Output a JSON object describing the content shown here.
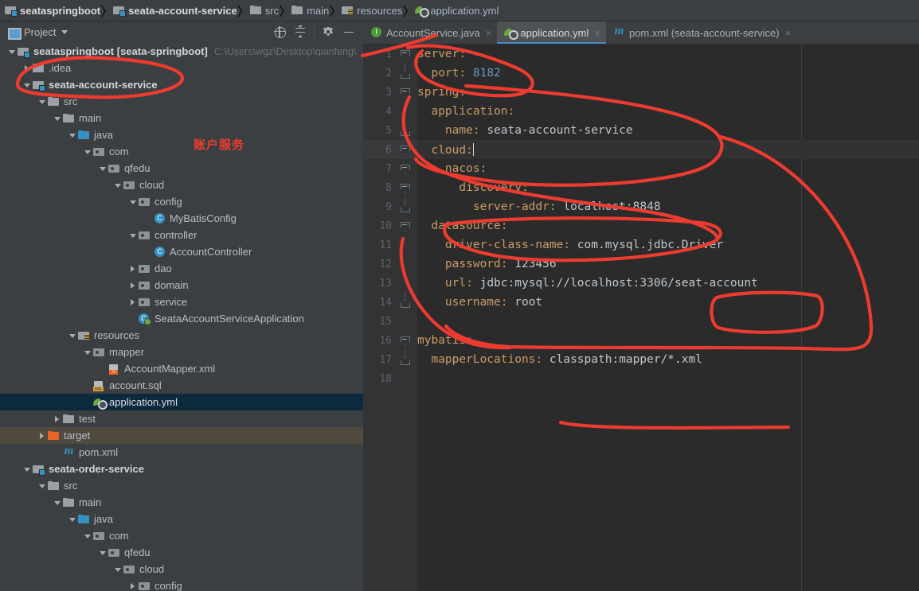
{
  "breadcrumb": [
    {
      "label": "seataspringboot",
      "icon": "module-icon",
      "bold": true
    },
    {
      "label": "seata-account-service",
      "icon": "module-icon",
      "bold": true
    },
    {
      "label": "src",
      "icon": "folder-icon",
      "bold": false
    },
    {
      "label": "main",
      "icon": "folder-icon",
      "bold": false
    },
    {
      "label": "resources",
      "icon": "resources-folder-icon",
      "bold": false
    },
    {
      "label": "application.yml",
      "icon": "yml-icon",
      "bold": false
    }
  ],
  "sidebar": {
    "title": "Project",
    "tools": [
      {
        "name": "locate-icon",
        "label": ""
      },
      {
        "name": "collapse-all-icon",
        "label": ""
      },
      {
        "name": "settings-gear-icon",
        "label": ""
      },
      {
        "name": "minimize-icon",
        "label": ""
      }
    ],
    "annotation_cn": "账户服务",
    "tree": [
      {
        "label": "seataspringboot [seata-springboot]",
        "path": "C:\\Users\\wgz\\Desktop\\qianfeng\\",
        "depth": 0,
        "arrow": "down",
        "icon": "module-icon",
        "bold": true,
        "state": "none"
      },
      {
        "label": ".idea",
        "depth": 1,
        "arrow": "right",
        "icon": "folder-icon",
        "bold": false,
        "state": "none"
      },
      {
        "label": "seata-account-service",
        "depth": 1,
        "arrow": "down",
        "icon": "module-icon",
        "bold": true,
        "state": "none"
      },
      {
        "label": "src",
        "depth": 2,
        "arrow": "down",
        "icon": "folder-icon",
        "bold": false,
        "state": "none"
      },
      {
        "label": "main",
        "depth": 3,
        "arrow": "down",
        "icon": "folder-icon",
        "bold": false,
        "state": "none"
      },
      {
        "label": "java",
        "depth": 4,
        "arrow": "down",
        "icon": "java-folder-icon",
        "bold": false,
        "state": "none"
      },
      {
        "label": "com",
        "depth": 5,
        "arrow": "down",
        "icon": "package-icon",
        "bold": false,
        "state": "none"
      },
      {
        "label": "qfedu",
        "depth": 6,
        "arrow": "down",
        "icon": "package-icon",
        "bold": false,
        "state": "none"
      },
      {
        "label": "cloud",
        "depth": 7,
        "arrow": "down",
        "icon": "package-icon",
        "bold": false,
        "state": "none"
      },
      {
        "label": "config",
        "depth": 8,
        "arrow": "down",
        "icon": "package-icon",
        "bold": false,
        "state": "none"
      },
      {
        "label": "MyBatisConfig",
        "depth": 9,
        "arrow": "none",
        "icon": "class-icon",
        "bold": false,
        "state": "none"
      },
      {
        "label": "controller",
        "depth": 8,
        "arrow": "down",
        "icon": "package-icon",
        "bold": false,
        "state": "none"
      },
      {
        "label": "AccountController",
        "depth": 9,
        "arrow": "none",
        "icon": "class-icon",
        "bold": false,
        "state": "none"
      },
      {
        "label": "dao",
        "depth": 8,
        "arrow": "right",
        "icon": "package-icon",
        "bold": false,
        "state": "none"
      },
      {
        "label": "domain",
        "depth": 8,
        "arrow": "right",
        "icon": "package-icon",
        "bold": false,
        "state": "none"
      },
      {
        "label": "service",
        "depth": 8,
        "arrow": "right",
        "icon": "package-icon",
        "bold": false,
        "state": "none"
      },
      {
        "label": "SeataAccountServiceApplication",
        "depth": 8,
        "arrow": "none",
        "icon": "spring-class-icon",
        "bold": false,
        "state": "none"
      },
      {
        "label": "resources",
        "depth": 4,
        "arrow": "down",
        "icon": "resources-folder-icon",
        "bold": false,
        "state": "none"
      },
      {
        "label": "mapper",
        "depth": 5,
        "arrow": "down",
        "icon": "package-icon",
        "bold": false,
        "state": "none"
      },
      {
        "label": "AccountMapper.xml",
        "depth": 6,
        "arrow": "none",
        "icon": "xml-icon",
        "bold": false,
        "state": "none"
      },
      {
        "label": "account.sql",
        "depth": 5,
        "arrow": "none",
        "icon": "sql-icon",
        "bold": false,
        "state": "none"
      },
      {
        "label": "application.yml",
        "depth": 5,
        "arrow": "none",
        "icon": "yml-icon",
        "bold": false,
        "state": "selected"
      },
      {
        "label": "test",
        "depth": 3,
        "arrow": "right",
        "icon": "folder-icon",
        "bold": false,
        "state": "none"
      },
      {
        "label": "target",
        "depth": 2,
        "arrow": "right",
        "icon": "target-folder-icon",
        "bold": false,
        "state": "highlight"
      },
      {
        "label": "pom.xml",
        "depth": 3,
        "arrow": "none",
        "icon": "maven-icon",
        "bold": false,
        "state": "none"
      },
      {
        "label": "seata-order-service",
        "depth": 1,
        "arrow": "down",
        "icon": "module-icon",
        "bold": true,
        "state": "none"
      },
      {
        "label": "src",
        "depth": 2,
        "arrow": "down",
        "icon": "folder-icon",
        "bold": false,
        "state": "none"
      },
      {
        "label": "main",
        "depth": 3,
        "arrow": "down",
        "icon": "folder-icon",
        "bold": false,
        "state": "none"
      },
      {
        "label": "java",
        "depth": 4,
        "arrow": "down",
        "icon": "java-folder-icon",
        "bold": false,
        "state": "none"
      },
      {
        "label": "com",
        "depth": 5,
        "arrow": "down",
        "icon": "package-icon",
        "bold": false,
        "state": "none"
      },
      {
        "label": "qfedu",
        "depth": 6,
        "arrow": "down",
        "icon": "package-icon",
        "bold": false,
        "state": "none"
      },
      {
        "label": "cloud",
        "depth": 7,
        "arrow": "down",
        "icon": "package-icon",
        "bold": false,
        "state": "none"
      },
      {
        "label": "config",
        "depth": 8,
        "arrow": "right",
        "icon": "package-icon",
        "bold": false,
        "state": "none"
      }
    ]
  },
  "editor": {
    "tabs": [
      {
        "label": "AccountService.java",
        "icon": "interface-icon",
        "active": false,
        "close": "×"
      },
      {
        "label": "application.yml",
        "icon": "yml-icon",
        "active": true,
        "close": "×"
      },
      {
        "label": "pom.xml (seata-account-service)",
        "icon": "maven-icon",
        "active": false,
        "close": "×"
      }
    ],
    "filename": "application.yml",
    "current_line": 6,
    "lines": [
      {
        "num": "1",
        "fold": "top",
        "indent": 0,
        "key": "server",
        "sep": ":",
        "value": "",
        "vtype": "none"
      },
      {
        "num": "2",
        "fold": "bot",
        "indent": 1,
        "key": "port",
        "sep": ": ",
        "value": "8182",
        "vtype": "num"
      },
      {
        "num": "3",
        "fold": "top",
        "indent": 0,
        "key": "spring",
        "sep": ":",
        "value": "",
        "vtype": "none"
      },
      {
        "num": "4",
        "fold": "mid",
        "indent": 1,
        "key": "application",
        "sep": ":",
        "value": "",
        "vtype": "none"
      },
      {
        "num": "5",
        "fold": "bot",
        "indent": 2,
        "key": "name",
        "sep": ": ",
        "value": "seata-account-service",
        "vtype": "str"
      },
      {
        "num": "6",
        "fold": "top",
        "indent": 1,
        "key": "cloud",
        "sep": ":",
        "value": "",
        "vtype": "caret"
      },
      {
        "num": "7",
        "fold": "top",
        "indent": 2,
        "key": "nacos",
        "sep": ":",
        "value": "",
        "vtype": "none"
      },
      {
        "num": "8",
        "fold": "top",
        "indent": 3,
        "key": "discovery",
        "sep": ":",
        "value": "",
        "vtype": "none"
      },
      {
        "num": "9",
        "fold": "bot",
        "indent": 4,
        "key": "server-addr",
        "sep": ": ",
        "value": "localhost:8848",
        "vtype": "str"
      },
      {
        "num": "10",
        "fold": "top",
        "indent": 1,
        "key": "datasource",
        "sep": ":",
        "value": "",
        "vtype": "none"
      },
      {
        "num": "11",
        "fold": "none",
        "indent": 2,
        "key": "driver-class-name",
        "sep": ": ",
        "value": "com.mysql.jdbc.Driver",
        "vtype": "str"
      },
      {
        "num": "12",
        "fold": "none",
        "indent": 2,
        "key": "password",
        "sep": ": ",
        "value": "123456",
        "vtype": "str"
      },
      {
        "num": "13",
        "fold": "none",
        "indent": 2,
        "key": "url",
        "sep": ": ",
        "value": "jdbc:mysql://localhost:3306/seat-account",
        "vtype": "str"
      },
      {
        "num": "14",
        "fold": "bot",
        "indent": 2,
        "key": "username",
        "sep": ": ",
        "value": "root",
        "vtype": "str"
      },
      {
        "num": "15",
        "fold": "none",
        "indent": 0,
        "key": "",
        "sep": "",
        "value": "",
        "vtype": "none"
      },
      {
        "num": "16",
        "fold": "top",
        "indent": 0,
        "key": "mybatis",
        "sep": ":",
        "value": "",
        "vtype": "none"
      },
      {
        "num": "17",
        "fold": "bot",
        "indent": 1,
        "key": "mapperLocations",
        "sep": ": ",
        "value": "classpath:mapper/*.xml",
        "vtype": "str"
      },
      {
        "num": "18",
        "fold": "none",
        "indent": 0,
        "key": "",
        "sep": "",
        "value": "",
        "vtype": "none"
      }
    ]
  },
  "colors": {
    "annotation_red": "#ee3b2f",
    "key_orange": "#cc9b66",
    "value_gray": "#bfc7ce",
    "number_blue": "#6897bb",
    "selection_blue": "#0d293e",
    "editor_bg": "#2b2b2b",
    "panel_bg": "#3c3f41",
    "tab_active_underline": "#4a88c7"
  }
}
